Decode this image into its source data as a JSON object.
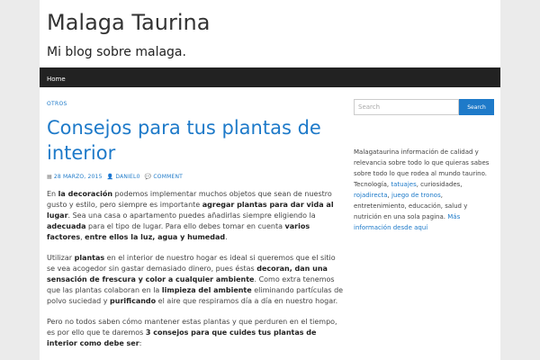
{
  "site": {
    "title": "Malaga Taurina",
    "description": "Mi blog sobre malaga."
  },
  "nav": {
    "home": "Home"
  },
  "post": {
    "category": "OTROS",
    "title": "Consejos para tus plantas de interior",
    "date": "28 MARZO, 2015",
    "author": "DANIEL0",
    "comment": "COMMENT"
  },
  "paragraphs": [
    [
      {
        "t": "En "
      },
      {
        "t": "la decoración",
        "b": true
      },
      {
        "t": " podemos implementar muchos objetos que sean de nuestro gusto y estilo, pero siempre es importante "
      },
      {
        "t": "agregar plantas para dar vida al lugar",
        "b": true
      },
      {
        "t": ". Sea una casa o apartamento puedes añadirlas siempre eligiendo la "
      },
      {
        "t": "adecuada",
        "b": true
      },
      {
        "t": " para el tipo de lugar. Para ello debes tomar en cuenta "
      },
      {
        "t": "varios factores",
        "b": true
      },
      {
        "t": ", "
      },
      {
        "t": "entre ellos la luz, agua y humedad",
        "b": true
      },
      {
        "t": "."
      }
    ],
    [
      {
        "t": "Utilizar "
      },
      {
        "t": "plantas",
        "b": true
      },
      {
        "t": " en el interior de nuestro hogar es ideal si queremos que el sitio se vea acogedor sin gastar demasiado dinero, pues éstas "
      },
      {
        "t": "decoran, dan una sensación de frescura y color a cualquier ambiente",
        "b": true
      },
      {
        "t": ". Como extra tenemos que las plantas colaboran en la "
      },
      {
        "t": "limpieza del ambiente",
        "b": true
      },
      {
        "t": " eliminando partículas de polvo suciedad y "
      },
      {
        "t": "purificando",
        "b": true
      },
      {
        "t": " el aire que respiramos día a día en nuestro hogar."
      }
    ],
    [
      {
        "t": "Pero no todos saben cómo mantener estas plantas y que perduren en el tiempo, es por ello que te daremos "
      },
      {
        "t": "3 consejos para que cuides tus plantas de interior como debe ser",
        "b": true
      },
      {
        "t": ":"
      }
    ]
  ],
  "sidebar": {
    "search_placeholder": "Search",
    "search_button": "Search",
    "about": [
      {
        "t": "Malagataurina información de calidad y relevancia sobre todo lo que quieras sabes sobre todo lo que rodea al mundo taurino. Tecnología, "
      },
      {
        "t": "tatuajes",
        "link": true
      },
      {
        "t": ", curiosidades, "
      },
      {
        "t": "rojadirecta",
        "link": true
      },
      {
        "t": ", "
      },
      {
        "t": "juego de tronos",
        "link": true
      },
      {
        "t": ", entretenimiento, educación, salud y nutrición en una sola pagina. "
      },
      {
        "t": "Más información desde aquí",
        "link": true
      }
    ]
  },
  "colors": {
    "accent": "#1e7ac9",
    "navbar": "#222222",
    "background": "#ebebeb"
  },
  "icons": {
    "date": "calendar-icon",
    "author": "user-icon",
    "comment": "comment-icon"
  }
}
